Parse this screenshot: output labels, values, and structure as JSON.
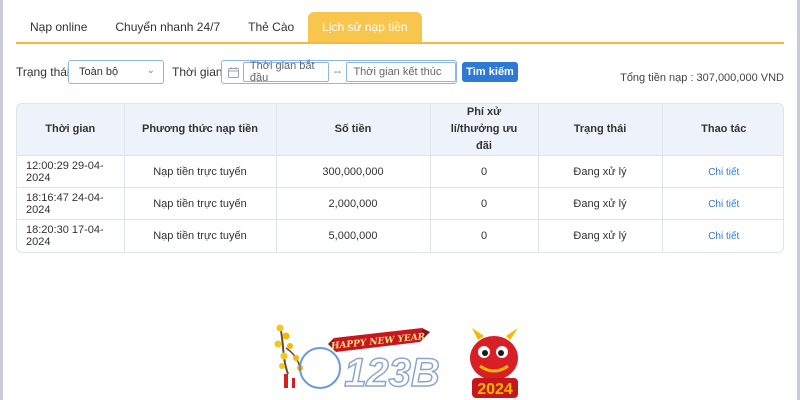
{
  "tabs": [
    {
      "label": "Nạp online"
    },
    {
      "label": "Chuyển nhanh 24/7"
    },
    {
      "label": "Thẻ Cào"
    },
    {
      "label": "Lịch sử nạp tiền"
    }
  ],
  "active_tab": "Lịch sử nạp tiền",
  "filters": {
    "status_label": "Trạng thái",
    "status_value": "Toàn bộ",
    "time_label": "Thời gian",
    "start_placeholder": "Thời gian bắt đầu",
    "range_separator": "--",
    "end_placeholder": "Thời gian kết thúc",
    "search_button": "Tìm kiếm"
  },
  "total_text": "Tổng tiền nạp : 307,000,000 VND",
  "table": {
    "headers": [
      "Thời gian",
      "Phương thức nạp tiền",
      "Số tiền",
      "Phí xử lí/thưởng ưu đãi",
      "Trạng thái",
      "Thao tác"
    ],
    "rows": [
      [
        "12:00:29 29-04-2024",
        "Nạp tiền trực tuyến",
        "300,000,000",
        "0",
        "Đang xử lý",
        "Chi tiết"
      ],
      [
        "18:16:47 24-04-2024",
        "Nạp tiền trực tuyến",
        "2,000,000",
        "0",
        "Đang xử lý",
        "Chi tiết"
      ],
      [
        "18:20:30 17-04-2024",
        "Nạp tiền trực tuyến",
        "5,000,000",
        "0",
        "Đang xử lý",
        "Chi tiết"
      ]
    ]
  },
  "logo": {
    "banner_text": "HAPPY NEW YEAR",
    "brand_text": "123B",
    "year_text": "2024"
  },
  "colors": {
    "accent": "#f8c54d",
    "link": "#2d7ad6",
    "header_bg": "#eef3fb"
  }
}
